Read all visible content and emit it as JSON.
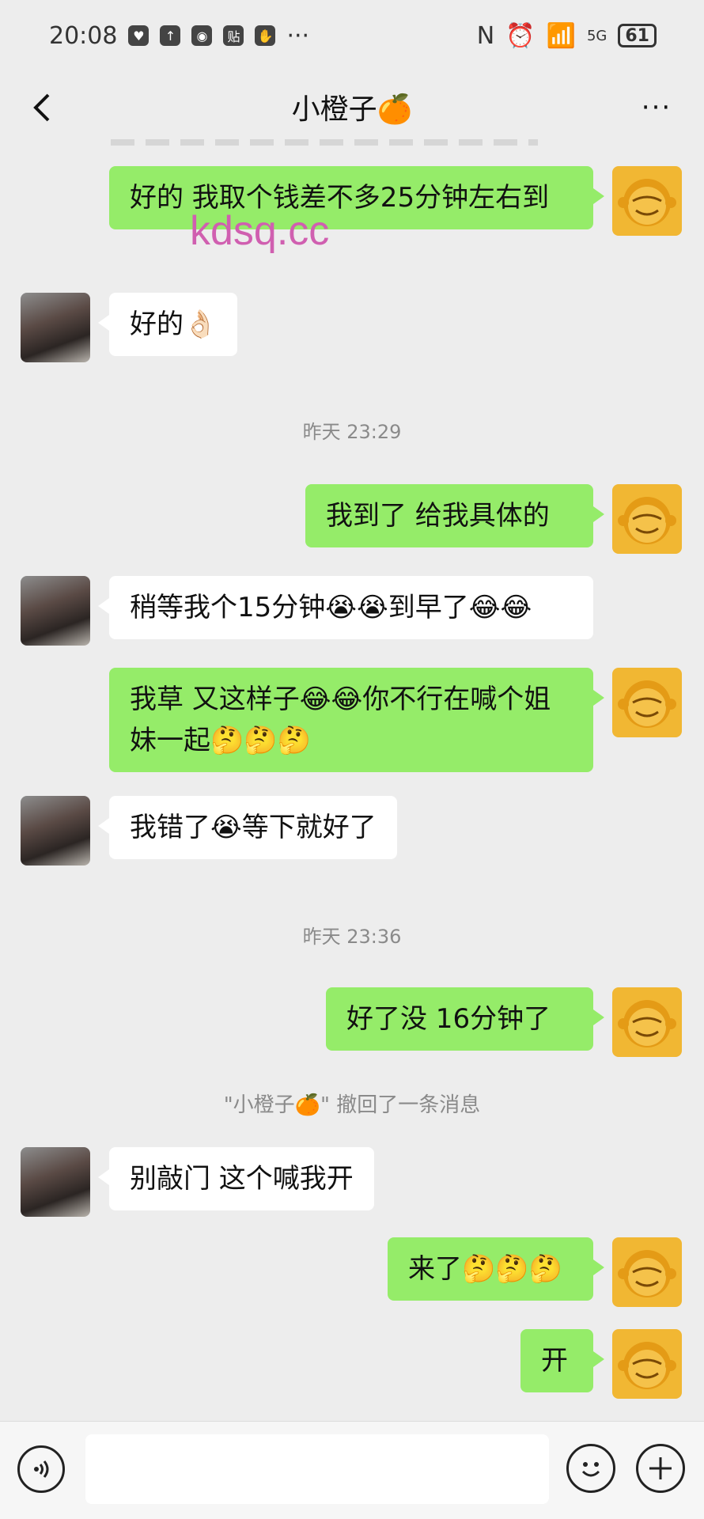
{
  "status_bar": {
    "time": "20:08",
    "signal": "5G",
    "battery": "61"
  },
  "header": {
    "title": "小橙子🍊",
    "back_icon": "chevron-left-icon",
    "more": "···"
  },
  "watermark": "kdsq.cc",
  "messages": [
    {
      "side": "me",
      "text": "好的 我取个钱差不多25分钟左右到"
    },
    {
      "side": "other",
      "text": "好的👌🏻"
    },
    {
      "side": "time",
      "text": "昨天 23:29"
    },
    {
      "side": "me",
      "text": "我到了 给我具体的"
    },
    {
      "side": "other",
      "text": "稍等我个15分钟😭😭到早了😂😂"
    },
    {
      "side": "me",
      "text": "我草 又这样子😂😂你不行在喊个姐妹一起🤔🤔🤔"
    },
    {
      "side": "other",
      "text": "我错了😭等下就好了"
    },
    {
      "side": "time",
      "text": "昨天 23:36"
    },
    {
      "side": "me",
      "text": "好了没 16分钟了"
    },
    {
      "side": "notice",
      "text": "\"小橙子🍊\" 撤回了一条消息"
    },
    {
      "side": "other",
      "text": "别敲门 这个喊我开"
    },
    {
      "side": "me",
      "text": "来了🤔🤔🤔"
    },
    {
      "side": "me",
      "text": "开"
    }
  ],
  "input_bar": {
    "placeholder": ""
  },
  "colors": {
    "my_bubble": "#95ec69",
    "other_bubble": "#ffffff",
    "background": "#ededed"
  }
}
